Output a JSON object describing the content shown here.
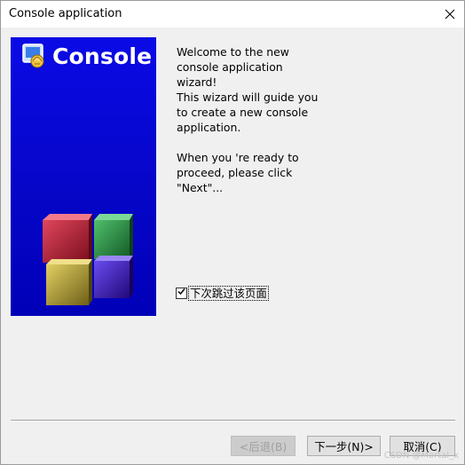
{
  "window": {
    "title": "Console application"
  },
  "banner": {
    "title": "Console"
  },
  "intro": {
    "paragraph1": "Welcome to the new\nconsole application\nwizard!\nThis wizard will guide you\nto create a new console\napplication.",
    "paragraph2": "When you 're ready to\nproceed, please click\n\"Next\"..."
  },
  "skip_checkbox": {
    "label": "下次跳过该页面",
    "checked": true
  },
  "buttons": {
    "back_label": "<后退(B)",
    "next_label": "下一步(N)>",
    "cancel_label": "取消(C)"
  },
  "watermark": {
    "text": "CSDN @Mortal_x"
  },
  "icons": {
    "close": "close-icon",
    "banner_logo": "console-logo-icon",
    "cubes": "cubes-graphic-icon",
    "checkmark": "checkmark-icon"
  },
  "colors": {
    "banner_blue": "#0606c8",
    "cube_red": "#b3162d",
    "cube_green": "#1e8a3c",
    "cube_yellow": "#b4a230",
    "cube_purple": "#3a16b8"
  }
}
